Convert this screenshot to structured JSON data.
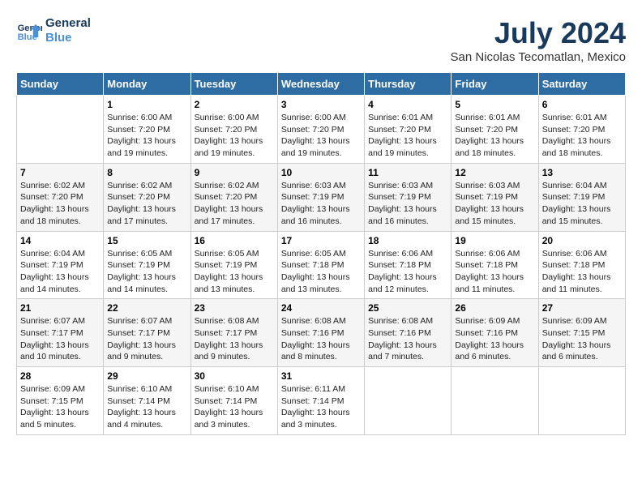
{
  "header": {
    "logo_line1": "General",
    "logo_line2": "Blue",
    "month": "July 2024",
    "location": "San Nicolas Tecomatlan, Mexico"
  },
  "weekdays": [
    "Sunday",
    "Monday",
    "Tuesday",
    "Wednesday",
    "Thursday",
    "Friday",
    "Saturday"
  ],
  "weeks": [
    [
      {
        "day": "",
        "info": ""
      },
      {
        "day": "1",
        "info": "Sunrise: 6:00 AM\nSunset: 7:20 PM\nDaylight: 13 hours\nand 19 minutes."
      },
      {
        "day": "2",
        "info": "Sunrise: 6:00 AM\nSunset: 7:20 PM\nDaylight: 13 hours\nand 19 minutes."
      },
      {
        "day": "3",
        "info": "Sunrise: 6:00 AM\nSunset: 7:20 PM\nDaylight: 13 hours\nand 19 minutes."
      },
      {
        "day": "4",
        "info": "Sunrise: 6:01 AM\nSunset: 7:20 PM\nDaylight: 13 hours\nand 19 minutes."
      },
      {
        "day": "5",
        "info": "Sunrise: 6:01 AM\nSunset: 7:20 PM\nDaylight: 13 hours\nand 18 minutes."
      },
      {
        "day": "6",
        "info": "Sunrise: 6:01 AM\nSunset: 7:20 PM\nDaylight: 13 hours\nand 18 minutes."
      }
    ],
    [
      {
        "day": "7",
        "info": "Sunrise: 6:02 AM\nSunset: 7:20 PM\nDaylight: 13 hours\nand 18 minutes."
      },
      {
        "day": "8",
        "info": "Sunrise: 6:02 AM\nSunset: 7:20 PM\nDaylight: 13 hours\nand 17 minutes."
      },
      {
        "day": "9",
        "info": "Sunrise: 6:02 AM\nSunset: 7:20 PM\nDaylight: 13 hours\nand 17 minutes."
      },
      {
        "day": "10",
        "info": "Sunrise: 6:03 AM\nSunset: 7:19 PM\nDaylight: 13 hours\nand 16 minutes."
      },
      {
        "day": "11",
        "info": "Sunrise: 6:03 AM\nSunset: 7:19 PM\nDaylight: 13 hours\nand 16 minutes."
      },
      {
        "day": "12",
        "info": "Sunrise: 6:03 AM\nSunset: 7:19 PM\nDaylight: 13 hours\nand 15 minutes."
      },
      {
        "day": "13",
        "info": "Sunrise: 6:04 AM\nSunset: 7:19 PM\nDaylight: 13 hours\nand 15 minutes."
      }
    ],
    [
      {
        "day": "14",
        "info": "Sunrise: 6:04 AM\nSunset: 7:19 PM\nDaylight: 13 hours\nand 14 minutes."
      },
      {
        "day": "15",
        "info": "Sunrise: 6:05 AM\nSunset: 7:19 PM\nDaylight: 13 hours\nand 14 minutes."
      },
      {
        "day": "16",
        "info": "Sunrise: 6:05 AM\nSunset: 7:19 PM\nDaylight: 13 hours\nand 13 minutes."
      },
      {
        "day": "17",
        "info": "Sunrise: 6:05 AM\nSunset: 7:18 PM\nDaylight: 13 hours\nand 13 minutes."
      },
      {
        "day": "18",
        "info": "Sunrise: 6:06 AM\nSunset: 7:18 PM\nDaylight: 13 hours\nand 12 minutes."
      },
      {
        "day": "19",
        "info": "Sunrise: 6:06 AM\nSunset: 7:18 PM\nDaylight: 13 hours\nand 11 minutes."
      },
      {
        "day": "20",
        "info": "Sunrise: 6:06 AM\nSunset: 7:18 PM\nDaylight: 13 hours\nand 11 minutes."
      }
    ],
    [
      {
        "day": "21",
        "info": "Sunrise: 6:07 AM\nSunset: 7:17 PM\nDaylight: 13 hours\nand 10 minutes."
      },
      {
        "day": "22",
        "info": "Sunrise: 6:07 AM\nSunset: 7:17 PM\nDaylight: 13 hours\nand 9 minutes."
      },
      {
        "day": "23",
        "info": "Sunrise: 6:08 AM\nSunset: 7:17 PM\nDaylight: 13 hours\nand 9 minutes."
      },
      {
        "day": "24",
        "info": "Sunrise: 6:08 AM\nSunset: 7:16 PM\nDaylight: 13 hours\nand 8 minutes."
      },
      {
        "day": "25",
        "info": "Sunrise: 6:08 AM\nSunset: 7:16 PM\nDaylight: 13 hours\nand 7 minutes."
      },
      {
        "day": "26",
        "info": "Sunrise: 6:09 AM\nSunset: 7:16 PM\nDaylight: 13 hours\nand 6 minutes."
      },
      {
        "day": "27",
        "info": "Sunrise: 6:09 AM\nSunset: 7:15 PM\nDaylight: 13 hours\nand 6 minutes."
      }
    ],
    [
      {
        "day": "28",
        "info": "Sunrise: 6:09 AM\nSunset: 7:15 PM\nDaylight: 13 hours\nand 5 minutes."
      },
      {
        "day": "29",
        "info": "Sunrise: 6:10 AM\nSunset: 7:14 PM\nDaylight: 13 hours\nand 4 minutes."
      },
      {
        "day": "30",
        "info": "Sunrise: 6:10 AM\nSunset: 7:14 PM\nDaylight: 13 hours\nand 3 minutes."
      },
      {
        "day": "31",
        "info": "Sunrise: 6:11 AM\nSunset: 7:14 PM\nDaylight: 13 hours\nand 3 minutes."
      },
      {
        "day": "",
        "info": ""
      },
      {
        "day": "",
        "info": ""
      },
      {
        "day": "",
        "info": ""
      }
    ]
  ]
}
